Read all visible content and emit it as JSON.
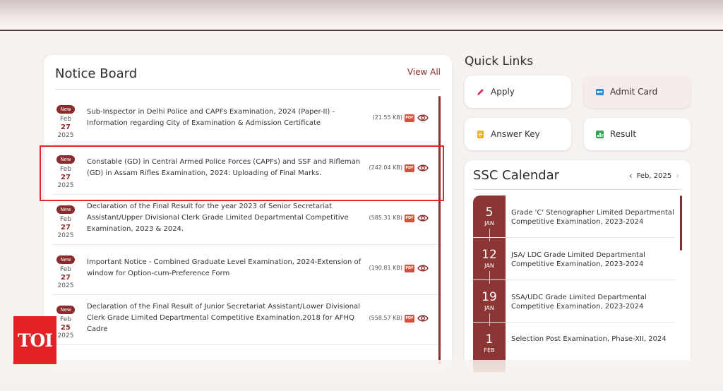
{
  "notice_board": {
    "title": "Notice Board",
    "view_all": "View All",
    "items": [
      {
        "badge": "New",
        "month": "Feb",
        "day": "27",
        "year": "2025",
        "text": "Sub-Inspector in Delhi Police and CAPFs Examination, 2024 (Paper-II) - Information regarding City of Examination & Admission Certificate",
        "size": "(21.55 KB)",
        "pdf": "PDF"
      },
      {
        "badge": "New",
        "month": "Feb",
        "day": "27",
        "year": "2025",
        "text": "Constable (GD) in Central Armed Police Forces (CAPFs) and SSF and Rifleman (GD) in Assam Rifles Examination, 2024: Uploading of Final Marks.",
        "size": "(242.04 KB)",
        "pdf": "PDF"
      },
      {
        "badge": "New",
        "month": "Feb",
        "day": "27",
        "year": "2025",
        "text": "Declaration of the Final Result for the year 2023 of Senior Secretariat Assistant/Upper Divisional Clerk Grade Limited Departmental Competitive Examination, 2023 & 2024.",
        "size": "(585.31 KB)",
        "pdf": "PDF"
      },
      {
        "badge": "New",
        "month": "Feb",
        "day": "27",
        "year": "2025",
        "text": "Important Notice - Combined Graduate Level Examination, 2024-Extension of window for Option-cum-Preference Form",
        "size": "(190.81 KB)",
        "pdf": "PDF"
      },
      {
        "badge": "New",
        "month": "Feb",
        "day": "25",
        "year": "2025",
        "text": "Declaration of the Final Result of Junior Secretariat Assistant/Lower Divisional Clerk Grade Limited Departmental Competitive Examination,2018 for AFHQ Cadre",
        "size": "(558.57 KB)",
        "pdf": "PDF"
      }
    ]
  },
  "quick_links": {
    "title": "Quick Links",
    "items": [
      {
        "label": "Apply",
        "icon": "pencil-icon",
        "color": "#e0305a"
      },
      {
        "label": "Admit Card",
        "icon": "id-card-icon",
        "color": "#2d8fd5"
      },
      {
        "label": "Answer Key",
        "icon": "document-icon",
        "color": "#f2b01e"
      },
      {
        "label": "Result",
        "icon": "bar-chart-icon",
        "color": "#2aa84a"
      }
    ]
  },
  "calendar": {
    "title": "SSC Calendar",
    "month_label": "Feb, 2025",
    "events": [
      {
        "day": "5",
        "month": "JAN",
        "text": "Grade 'C' Stenographer Limited Departmental Competitive Examination, 2023-2024"
      },
      {
        "day": "12",
        "month": "JAN",
        "text": "JSA/ LDC Grade Limited Departmental Competitive Examination, 2023-2024"
      },
      {
        "day": "19",
        "month": "JAN",
        "text": "SSA/UDC Grade Limited Departmental Competitive Examination, 2023-2024"
      },
      {
        "day": "1",
        "month": "FEB",
        "text": "Selection Post Examination, Phase-XII, 2024"
      }
    ]
  },
  "logo": {
    "text": "TOI"
  },
  "colors": {
    "accent": "#8b2c2c",
    "highlight": "#e0262d",
    "logo_bg": "#e32227"
  }
}
